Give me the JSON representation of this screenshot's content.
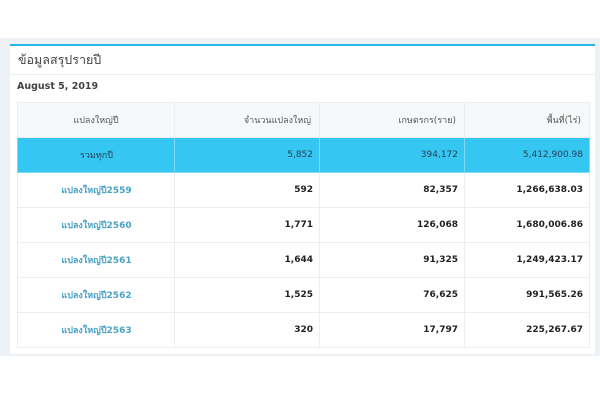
{
  "card": {
    "title": "ข้อมูลสรุปรายปี",
    "date": "August 5, 2019"
  },
  "table": {
    "headers": [
      "แปลงใหญ่ปี",
      "จำนวนแปลงใหญ่",
      "เกษตรกร(ราย)",
      "พื้นที่(ไร่)"
    ],
    "total": {
      "label": "รวมทุกปี",
      "plots": "5,852",
      "farmers": "394,172",
      "area": "5,412,900.98"
    },
    "rows": [
      {
        "label": "แปลงใหญ่ปี2559",
        "plots": "592",
        "farmers": "82,357",
        "area": "1,266,638.03"
      },
      {
        "label": "แปลงใหญ่ปี2560",
        "plots": "1,771",
        "farmers": "126,068",
        "area": "1,680,006.86"
      },
      {
        "label": "แปลงใหญ่ปี2561",
        "plots": "1,644",
        "farmers": "91,325",
        "area": "1,249,423.17"
      },
      {
        "label": "แปลงใหญ่ปี2562",
        "plots": "1,525",
        "farmers": "76,625",
        "area": "991,565.26"
      },
      {
        "label": "แปลงใหญ่ปี2563",
        "plots": "320",
        "farmers": "17,797",
        "area": "225,267.67"
      }
    ]
  }
}
